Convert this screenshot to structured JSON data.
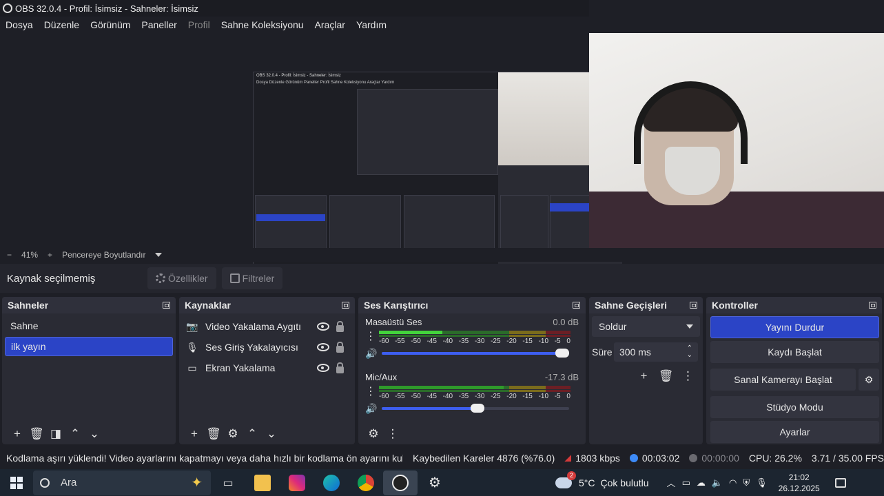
{
  "window": {
    "title": "OBS 32.0.4 - Profil: İsimsiz - Sahneler: İsimsiz"
  },
  "menu": [
    "Dosya",
    "Düzenle",
    "Görünüm",
    "Paneller",
    "Profil",
    "Sahne Koleksiyonu",
    "Araçlar",
    "Yardım"
  ],
  "preview": {
    "zoom_minus": "−",
    "zoom": "41%",
    "zoom_plus": "+",
    "fit": "Pencereye Boyutlandır"
  },
  "context": {
    "label": "Kaynak seçilmemiş",
    "properties": "Özellikler",
    "filters": "Filtreler"
  },
  "scenes": {
    "title": "Sahneler",
    "items": [
      "Sahne",
      "ilk yayın"
    ],
    "selected": 1
  },
  "sources": {
    "title": "Kaynaklar",
    "items": [
      {
        "label": "Video Yakalama Aygıtı",
        "icon": "camera-icon"
      },
      {
        "label": "Ses Giriş Yakalayıcısı",
        "icon": "microphone-icon"
      },
      {
        "label": "Ekran Yakalama",
        "icon": "monitor-icon"
      }
    ]
  },
  "mixer": {
    "title": "Ses Karıştırıcı",
    "scale": [
      "-60",
      "-55",
      "-50",
      "-45",
      "-40",
      "-35",
      "-30",
      "-25",
      "-20",
      "-15",
      "-10",
      "-5",
      "0"
    ],
    "channels": [
      {
        "name": "Masaüstü Ses",
        "db": "0.0 dB",
        "level": 0.33,
        "volume": 1.0
      },
      {
        "name": "Mic/Aux",
        "db": "-17.3 dB",
        "level": 0.65,
        "volume": 0.51
      }
    ]
  },
  "transitions": {
    "title": "Sahne Geçişleri",
    "selected": "Soldur",
    "duration_label": "Süre",
    "duration": "300 ms"
  },
  "controls": {
    "title": "Kontroller",
    "stop_stream": "Yayını Durdur",
    "start_record": "Kaydı Başlat",
    "start_virtualcam": "Sanal Kamerayı Başlat",
    "studio_mode": "Stüdyo Modu",
    "settings": "Ayarlar"
  },
  "status": {
    "warning": "Kodlama aşırı yüklendi! Video ayarlarını kapatmayı veya daha hızlı bir kodlama ön ayarını kullanmayı düşünün.",
    "dropped": "Kaybedilen Kareler 4876 (%76.0)",
    "bitrate": "1803 kbps",
    "stream_time": "00:03:02",
    "record_time": "00:00:00",
    "cpu": "CPU: 26.2%",
    "fps": "3.71 / 35.00 FPS",
    "colors": {
      "live": "#3d8af7",
      "bitrate": "#d33a3a",
      "record": "#6a6a70"
    }
  },
  "taskbar": {
    "search": "Ara",
    "weather_badge": "2",
    "temperature": "5°C",
    "weather": "Çok bulutlu",
    "time": "21:02",
    "date": "26.12.2025"
  },
  "nested": {
    "title": "OBS 32.0.4 - Profil: İsimsiz - Sahneler: İsimsiz",
    "menu": "Dosya  Düzenle  Görünüm  Paneller  Profil  Sahne Koleksiyonu  Araçlar  Yardım"
  }
}
